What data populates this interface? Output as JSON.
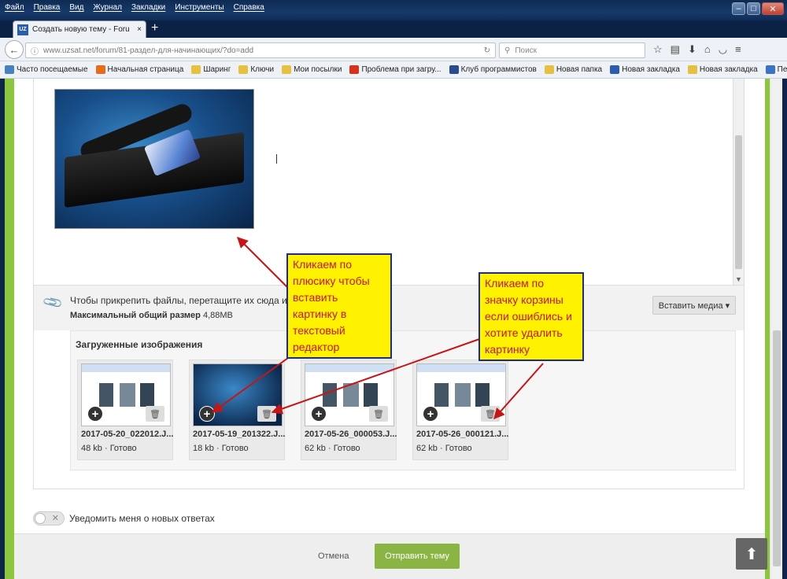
{
  "browser": {
    "menu": [
      "Файл",
      "Правка",
      "Вид",
      "Журнал",
      "Закладки",
      "Инструменты",
      "Справка"
    ],
    "window_buttons": [
      "–",
      "□",
      "✕"
    ],
    "tab": {
      "favicon": "UZ",
      "title": "Создать новую тему - Foru",
      "close": "×"
    },
    "new_tab": "+",
    "url": "www.uzsat.net/forum/81-раздел-для-начинающих/?do=add",
    "search_placeholder": "Поиск",
    "bookmarks": [
      {
        "label": "Часто посещаемые",
        "color": "#4a7fc0"
      },
      {
        "label": "Начальная страница",
        "color": "#e86a1c"
      },
      {
        "label": "Шаринг",
        "color": "#e8c040"
      },
      {
        "label": "Ключи",
        "color": "#e8c040"
      },
      {
        "label": "Мои посылки",
        "color": "#e8c040"
      },
      {
        "label": "Проблема при загру...",
        "color": "#d8321c"
      },
      {
        "label": "Клуб программистов",
        "color": "#2a4b90"
      },
      {
        "label": "Новая папка",
        "color": "#e8c040"
      },
      {
        "label": "Новая закладка",
        "color": "#2a5db0"
      },
      {
        "label": "Новая закладка",
        "color": "#e8c040"
      },
      {
        "label": "Переводчик",
        "color": "#3b73c9"
      }
    ]
  },
  "editor": {
    "attach_hint": "Чтобы прикрепить файлы, перетащите их сюда или",
    "max_size_label": "Максимальный общий размер",
    "max_size_value": "4,88MB",
    "insert_media": "Вставить медиа ▾"
  },
  "uploads": {
    "heading": "Загруженные изображения",
    "items": [
      {
        "name": "2017-05-20_022012.J...",
        "size": "48 kb",
        "status": "Готово"
      },
      {
        "name": "2017-05-19_201322.J...",
        "size": "18 kb",
        "status": "Готово"
      },
      {
        "name": "2017-05-26_000053.J...",
        "size": "62 kb",
        "status": "Готово"
      },
      {
        "name": "2017-05-26_000121.J...",
        "size": "62 kb",
        "status": "Готово"
      }
    ]
  },
  "notify_label": "Уведомить меня о новых ответах",
  "footer": {
    "cancel": "Отмена",
    "submit": "Отправить тему"
  },
  "annotations": {
    "plus": "Кликаем по плюсику чтобы вставить картинку в текстовый редактор",
    "trash": "Кликаем по значку корзины если ошиблись и хотите удалить картинку"
  }
}
